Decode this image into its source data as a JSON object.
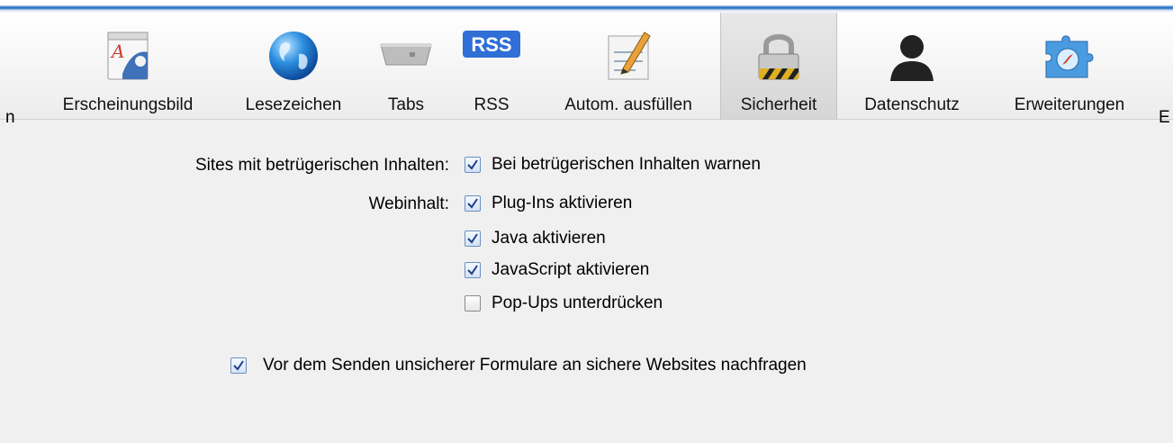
{
  "toolbar": {
    "cut_left": "n",
    "cut_right": "E",
    "items": [
      {
        "label": "Erscheinungsbild",
        "icon": "appearance-icon"
      },
      {
        "label": "Lesezeichen",
        "icon": "globe-icon"
      },
      {
        "label": "Tabs",
        "icon": "tabs-icon"
      },
      {
        "label": "RSS",
        "icon": "rss-icon",
        "badge": "RSS"
      },
      {
        "label": "Autom. ausfüllen",
        "icon": "autofill-pencil-icon"
      },
      {
        "label": "Sicherheit",
        "icon": "padlock-icon",
        "selected": true
      },
      {
        "label": "Datenschutz",
        "icon": "person-silhouette-icon"
      },
      {
        "label": "Erweiterungen",
        "icon": "puzzle-compass-icon"
      }
    ]
  },
  "security": {
    "fraud_label": "Sites mit betrügerischen Inhalten:",
    "fraud_warn": {
      "label": "Bei betrügerischen Inhalten warnen",
      "checked": true
    },
    "web_label": "Webinhalt:",
    "plugins": {
      "label": "Plug-Ins aktivieren",
      "checked": true
    },
    "java": {
      "label": "Java aktivieren",
      "checked": true
    },
    "javascript": {
      "label": "JavaScript aktivieren",
      "checked": true
    },
    "popups": {
      "label": "Pop-Ups unterdrücken",
      "checked": false
    },
    "insecure_forms": {
      "label": "Vor dem Senden unsicherer Formulare an sichere Websites nachfragen",
      "checked": true
    }
  }
}
